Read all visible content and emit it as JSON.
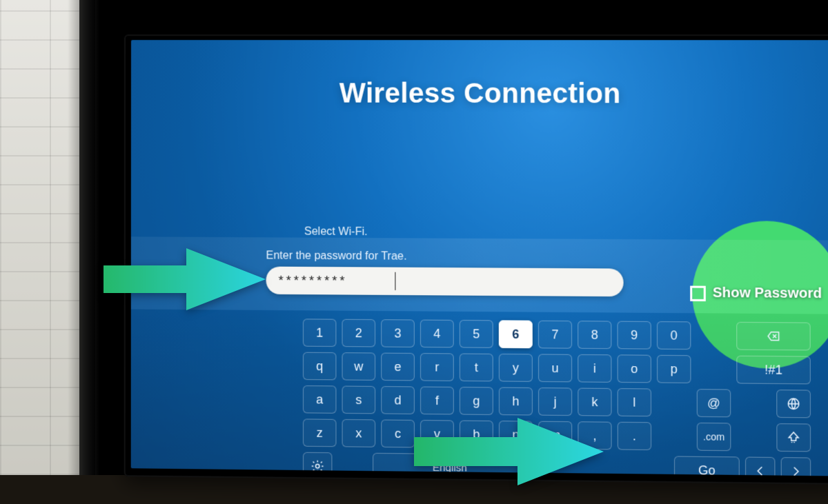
{
  "header": {
    "title": "Wireless Connection"
  },
  "subheader": {
    "select_wifi": "Select Wi-Fi."
  },
  "password": {
    "prompt": "Enter the password for Trae.",
    "masked_value": "*********",
    "show_password_label": "Show Password",
    "show_password_checked": false
  },
  "keyboard": {
    "row1": [
      "1",
      "2",
      "3",
      "4",
      "5",
      "6",
      "7",
      "8",
      "9",
      "0"
    ],
    "row1_active_index": 5,
    "row2": [
      "q",
      "w",
      "e",
      "r",
      "t",
      "y",
      "u",
      "i",
      "o",
      "p"
    ],
    "row3": [
      "a",
      "s",
      "d",
      "f",
      "g",
      "h",
      "j",
      "k",
      "l"
    ],
    "row4": [
      "z",
      "x",
      "c",
      "v",
      "b",
      "n",
      "m",
      ",",
      "."
    ],
    "backspace_icon": "backspace-icon",
    "symbols_key": "!#1",
    "at_key": "@",
    "globe_icon": "globe-icon",
    "com_key": ".com",
    "shift_icon": "shift-icon",
    "settings_icon": "gear-icon",
    "language_label": "English",
    "go_label": "Go",
    "left_icon": "chevron-left-icon",
    "right_icon": "chevron-right-icon"
  },
  "annotations": {
    "arrow_password": "arrow pointing to password field",
    "arrow_go": "arrow pointing to Go key"
  }
}
